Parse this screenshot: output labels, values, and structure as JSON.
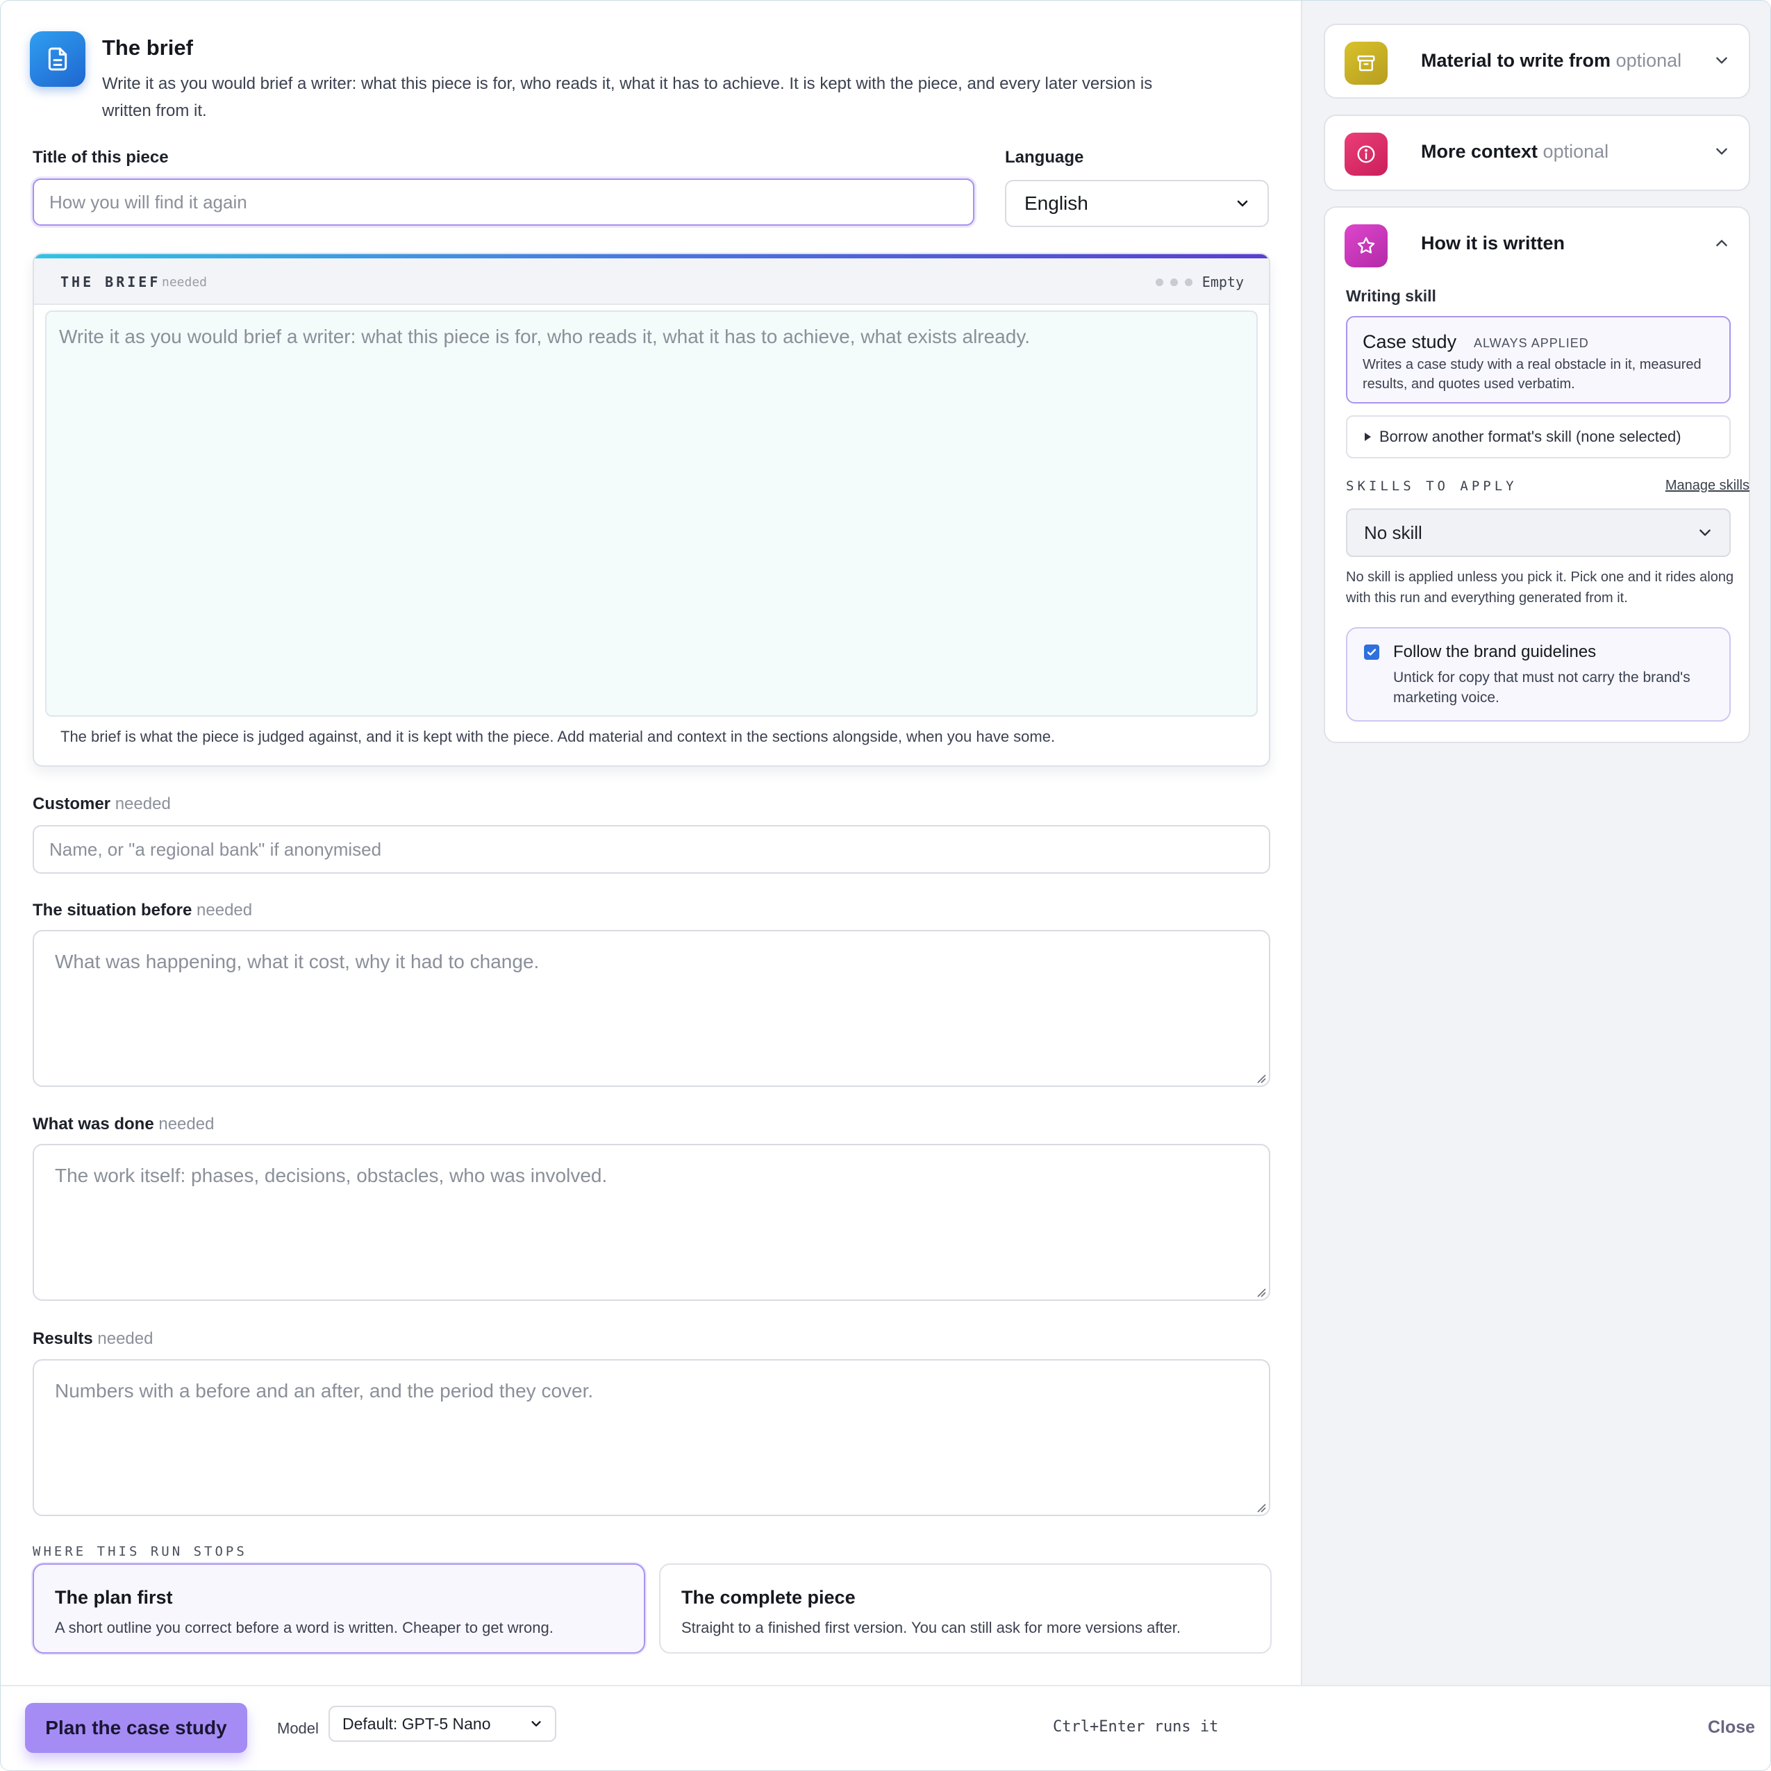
{
  "header": {
    "title": "The brief",
    "description": "Write it as you would brief a writer: what this piece is for, who reads it, what it has to achieve. It is kept with the piece, and every later version is written from it.",
    "icon": "document-icon"
  },
  "fields": {
    "title_label": "Title of this piece",
    "title_placeholder": "How you will find it again",
    "language_label": "Language",
    "language_value": "English"
  },
  "brief": {
    "name": "THE BRIEF",
    "tag": "needed",
    "status": "Empty",
    "placeholder": "Write it as you would brief a writer: what this piece is for, who reads it, what it has to achieve, what exists already.",
    "note": "The brief is what the piece is judged against, and it is kept with the piece. Add material and context in the sections alongside, when you have some."
  },
  "customer": {
    "label": "Customer",
    "tag": "needed",
    "placeholder": "Name, or \"a regional bank\" if anonymised"
  },
  "situation": {
    "label": "The situation before",
    "tag": "needed",
    "placeholder": "What was happening, what it cost, why it had to change."
  },
  "done": {
    "label": "What was done",
    "tag": "needed",
    "placeholder": "The work itself: phases, decisions, obstacles, who was involved."
  },
  "results": {
    "label": "Results",
    "tag": "needed",
    "placeholder": "Numbers with a before and an after, and the period they cover."
  },
  "stops": {
    "caption": "WHERE THIS RUN STOPS",
    "options": [
      {
        "title": "The plan first",
        "desc": "A short outline you correct before a word is written. Cheaper to get wrong.",
        "selected": true
      },
      {
        "title": "The complete piece",
        "desc": "Straight to a finished first version. You can still ask for more versions after.",
        "selected": false
      }
    ]
  },
  "footer": {
    "run_label": "Plan the case study",
    "model_label": "Model",
    "model_value": "Default: GPT-5 Nano",
    "shortcut": "Ctrl+Enter runs it",
    "close_label": "Close"
  },
  "sidebar": {
    "material": {
      "title": "Material to write from",
      "optional": "optional",
      "icon": "archive-box-icon",
      "color": "#c9b42a"
    },
    "context": {
      "title": "More context",
      "optional": "optional",
      "icon": "info-circle-icon",
      "color": "#e0306a"
    },
    "written": {
      "title": "How it is written",
      "icon": "star-icon",
      "color": "#d23cc0",
      "writing_skill_label": "Writing skill",
      "skill_name": "Case study",
      "skill_badge": "ALWAYS APPLIED",
      "skill_desc": "Writes a case study with a real obstacle in it, measured results, and quotes used verbatim.",
      "borrow_label": "Borrow another format's skill (none selected)",
      "skills_to_apply": "SKILLS TO APPLY",
      "manage_skills": "Manage skills",
      "skill_select_value": "No skill",
      "skill_note": "No skill is applied unless you pick it. Pick one and it rides along with this run and everything generated from it.",
      "brand_title": "Follow the brand guidelines",
      "brand_desc": "Untick for copy that must not carry the brand's marketing voice.",
      "brand_checked": true
    }
  }
}
